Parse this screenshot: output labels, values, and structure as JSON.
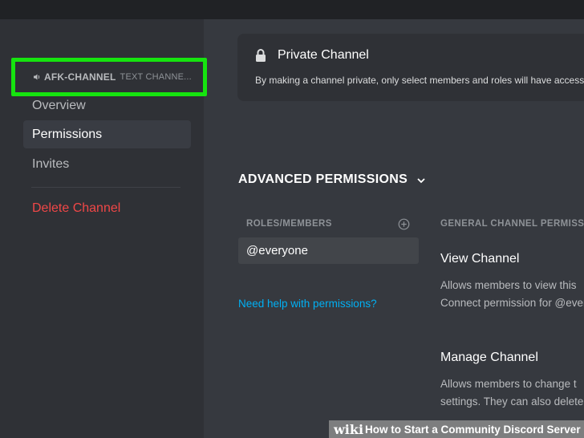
{
  "sidebar": {
    "channel_name": "AFK-CHANNEL",
    "channel_type": "TEXT CHANNE...",
    "items": [
      {
        "label": "Overview"
      },
      {
        "label": "Permissions"
      },
      {
        "label": "Invites"
      }
    ],
    "delete_label": "Delete Channel"
  },
  "private_channel": {
    "title": "Private Channel",
    "description": "By making a channel private, only select members and roles will have access"
  },
  "advanced": {
    "title": "ADVANCED PERMISSIONS",
    "roles_header": "ROLES/MEMBERS",
    "roles": [
      "@everyone"
    ],
    "help_link": "Need help with permissions?",
    "general_header": "GENERAL CHANNEL PERMISSIONS",
    "permissions": [
      {
        "title": "View Channel",
        "desc_line1": "Allows members to view this",
        "desc_line2": "Connect permission for @everyone"
      },
      {
        "title": "Manage Channel",
        "desc_line1": "Allows members to change t",
        "desc_line2": "settings. They can also delete"
      }
    ]
  },
  "watermark": {
    "logo": "wiki",
    "text": "How to Start a Community Discord Server"
  },
  "colors": {
    "highlight": "#16e40f",
    "danger": "#f04747",
    "link": "#00b0f4",
    "sidebar_bg": "#2f3136",
    "main_bg": "#36393f"
  },
  "icons": [
    "speaker-icon",
    "lock-icon",
    "chevron-down-icon",
    "add-circle-icon"
  ]
}
